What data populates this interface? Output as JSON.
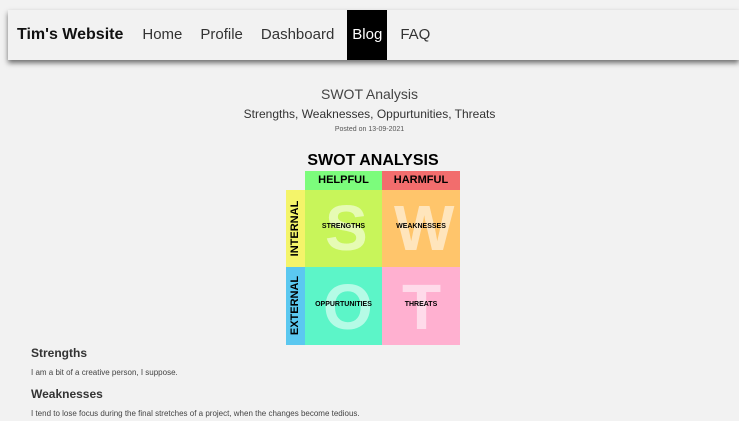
{
  "nav": {
    "brand": "Tim's Website",
    "links": [
      "Home",
      "Profile",
      "Dashboard",
      "Blog",
      "FAQ"
    ]
  },
  "post": {
    "title": "SWOT Analysis",
    "subtitle": "Strengths, Weaknesses, Oppurtunities, Threats",
    "posted": "Posted on 13-09-2021"
  },
  "swot_image": {
    "heading": "SWOT ANALYSIS",
    "helpful": "HELPFUL",
    "harmful": "HARMFUL",
    "internal": "INTERNAL",
    "external": "EXTERNAL",
    "strengths": "STRENGTHS",
    "weaknesses": "WEAKNESSES",
    "oppurtunities": "OPPURTUNITIES",
    "threats": "THREATS",
    "letters": [
      "S",
      "W",
      "O",
      "T"
    ],
    "colors": {
      "helpful": "#7cfc7c",
      "harmful": "#f26d6d",
      "internal": "#f4f46a",
      "external": "#5bc8f0",
      "strengths": "#c8f55a",
      "weaknesses": "#ffc56b",
      "oppurtunities": "#5cf5c8",
      "threats": "#ffb0d0"
    }
  },
  "sections": [
    {
      "heading": "Strengths",
      "text": "I am a bit of a creative person, I suppose."
    },
    {
      "heading": "Weaknesses",
      "text": "I tend to lose focus during the final stretches of a project, when the changes become tedious."
    }
  ]
}
